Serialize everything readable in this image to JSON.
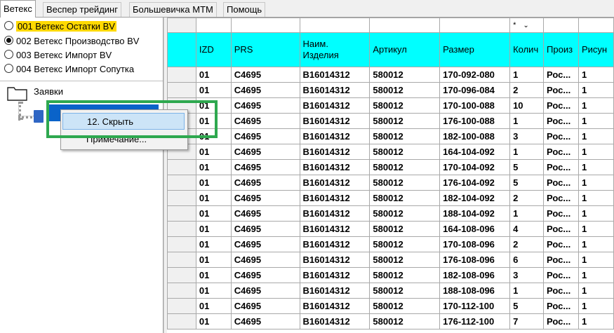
{
  "tabs": [
    "Ветекс",
    "Веспер трейдинг",
    "Большевичка МТМ",
    "Помощь"
  ],
  "radios": [
    {
      "label": "001 Ветекс Остатки BV",
      "checked": false,
      "highlight": true
    },
    {
      "label": "002 Ветекс Производство BV",
      "checked": true,
      "highlight": false
    },
    {
      "label": "003 Ветекс Импорт BV",
      "checked": false,
      "highlight": false
    },
    {
      "label": "004 Ветекс Импорт Сопутка",
      "checked": false,
      "highlight": false
    }
  ],
  "tree": {
    "folder_label": "Заявки"
  },
  "context_menu": {
    "items": [
      "12. Скрыть",
      "Примечание..."
    ]
  },
  "grid": {
    "filter_value": "*",
    "columns": [
      "IZD",
      "PRS",
      "Наим.\nИзделия",
      "Артикул",
      "Размер",
      "Колич",
      "Произ",
      "Рисун"
    ],
    "rows": [
      [
        "01",
        "C4695",
        "B16014312",
        "580012",
        "170-092-080",
        "1",
        "Рос...",
        "1"
      ],
      [
        "01",
        "C4695",
        "B16014312",
        "580012",
        "170-096-084",
        "2",
        "Рос...",
        "1"
      ],
      [
        "01",
        "C4695",
        "B16014312",
        "580012",
        "170-100-088",
        "10",
        "Рос...",
        "1"
      ],
      [
        "01",
        "C4695",
        "B16014312",
        "580012",
        "176-100-088",
        "1",
        "Рос...",
        "1"
      ],
      [
        "01",
        "C4695",
        "B16014312",
        "580012",
        "182-100-088",
        "3",
        "Рос...",
        "1"
      ],
      [
        "01",
        "C4695",
        "B16014312",
        "580012",
        "164-104-092",
        "1",
        "Рос...",
        "1"
      ],
      [
        "01",
        "C4695",
        "B16014312",
        "580012",
        "170-104-092",
        "5",
        "Рос...",
        "1"
      ],
      [
        "01",
        "C4695",
        "B16014312",
        "580012",
        "176-104-092",
        "5",
        "Рос...",
        "1"
      ],
      [
        "01",
        "C4695",
        "B16014312",
        "580012",
        "182-104-092",
        "2",
        "Рос...",
        "1"
      ],
      [
        "01",
        "C4695",
        "B16014312",
        "580012",
        "188-104-092",
        "1",
        "Рос...",
        "1"
      ],
      [
        "01",
        "C4695",
        "B16014312",
        "580012",
        "164-108-096",
        "4",
        "Рос...",
        "1"
      ],
      [
        "01",
        "C4695",
        "B16014312",
        "580012",
        "170-108-096",
        "2",
        "Рос...",
        "1"
      ],
      [
        "01",
        "C4695",
        "B16014312",
        "580012",
        "176-108-096",
        "6",
        "Рос...",
        "1"
      ],
      [
        "01",
        "C4695",
        "B16014312",
        "580012",
        "182-108-096",
        "3",
        "Рос...",
        "1"
      ],
      [
        "01",
        "C4695",
        "B16014312",
        "580012",
        "188-108-096",
        "1",
        "Рос...",
        "1"
      ],
      [
        "01",
        "C4695",
        "B16014312",
        "580012",
        "170-112-100",
        "5",
        "Рос...",
        "1"
      ],
      [
        "01",
        "C4695",
        "B16014312",
        "580012",
        "176-112-100",
        "7",
        "Рос...",
        "1"
      ]
    ]
  }
}
